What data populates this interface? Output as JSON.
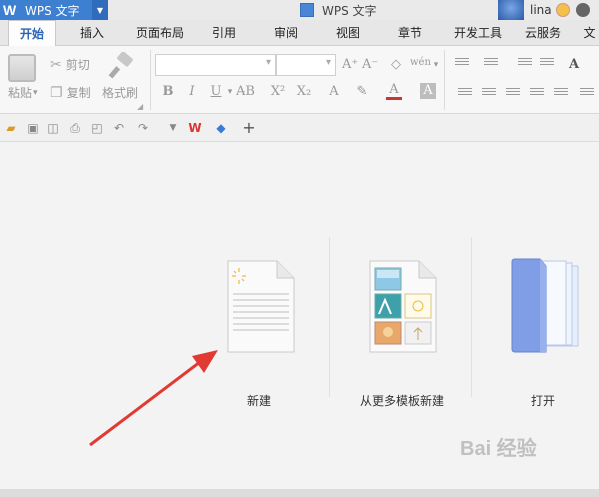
{
  "app": {
    "menu_label": "WPS 文字",
    "window_title": "WPS 文字",
    "user_name": "lina"
  },
  "tabs": [
    {
      "label": "开始",
      "active": true
    },
    {
      "label": "插入"
    },
    {
      "label": "页面布局"
    },
    {
      "label": "引用"
    },
    {
      "label": "审阅"
    },
    {
      "label": "视图"
    },
    {
      "label": "章节"
    },
    {
      "label": "开发工具"
    },
    {
      "label": "云服务"
    },
    {
      "label": "文"
    }
  ],
  "ribbon": {
    "paste_label": "粘贴",
    "cut_label": "剪切",
    "copy_label": "复制",
    "format_painter_label": "格式刷"
  },
  "start": {
    "new_label": "新建",
    "template_label": "从更多模板新建",
    "open_label": "打开"
  },
  "watermark": "Bai 经验",
  "colors": {
    "accent": "#3d7fd1",
    "arrow": "#e03a33"
  }
}
